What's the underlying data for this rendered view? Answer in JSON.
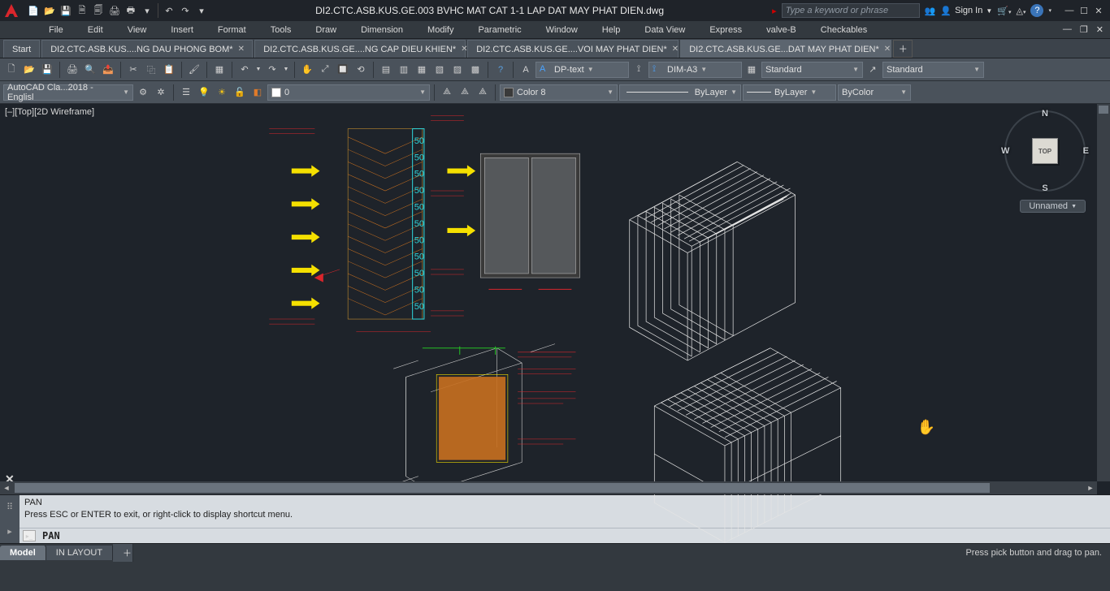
{
  "title": "DI2.CTC.ASB.KUS.GE.003 BVHC MAT CAT 1-1 LAP DAT MAY PHAT DIEN.dwg",
  "search_placeholder": "Type a keyword or phrase",
  "signin": "Sign In",
  "menu": [
    "File",
    "Edit",
    "View",
    "Insert",
    "Format",
    "Tools",
    "Draw",
    "Dimension",
    "Modify",
    "Parametric",
    "Window",
    "Help",
    "Data View",
    "Express",
    "valve-B",
    "Checkables"
  ],
  "tabs": {
    "start": "Start",
    "items": [
      "DI2.CTC.ASB.KUS....NG DAU PHONG BOM*",
      "DI2.CTC.ASB.KUS.GE....NG CAP DIEU KHIEN*",
      "DI2.CTC.ASB.KUS.GE....VOI MAY PHAT DIEN*",
      "DI2.CTC.ASB.KUS.GE...DAT MAY PHAT DIEN*"
    ],
    "active_index": 3
  },
  "ribbon": {
    "textstyle": "DP-text",
    "dimstyle": "DIM-A3",
    "tablestyle": "Standard",
    "mleaderstyle": "Standard",
    "workspace": "AutoCAD Cla...2018 - Englisl",
    "layer0": "0",
    "color": "Color 8",
    "linetype": "ByLayer",
    "lineweight": "ByLayer",
    "plotstyle": "ByColor"
  },
  "viewport_label": "[–][Top][2D Wireframe]",
  "viewcube": {
    "n": "N",
    "s": "S",
    "e": "E",
    "w": "W",
    "face": "TOP"
  },
  "unnamed": "Unnamed",
  "command": {
    "line1": "PAN",
    "line2": "Press ESC or ENTER to exit, or right-click to display shortcut menu.",
    "current": "PAN"
  },
  "layouts": {
    "model": "Model",
    "layout": "IN LAYOUT"
  },
  "status_right": "Press pick button and drag to pan."
}
